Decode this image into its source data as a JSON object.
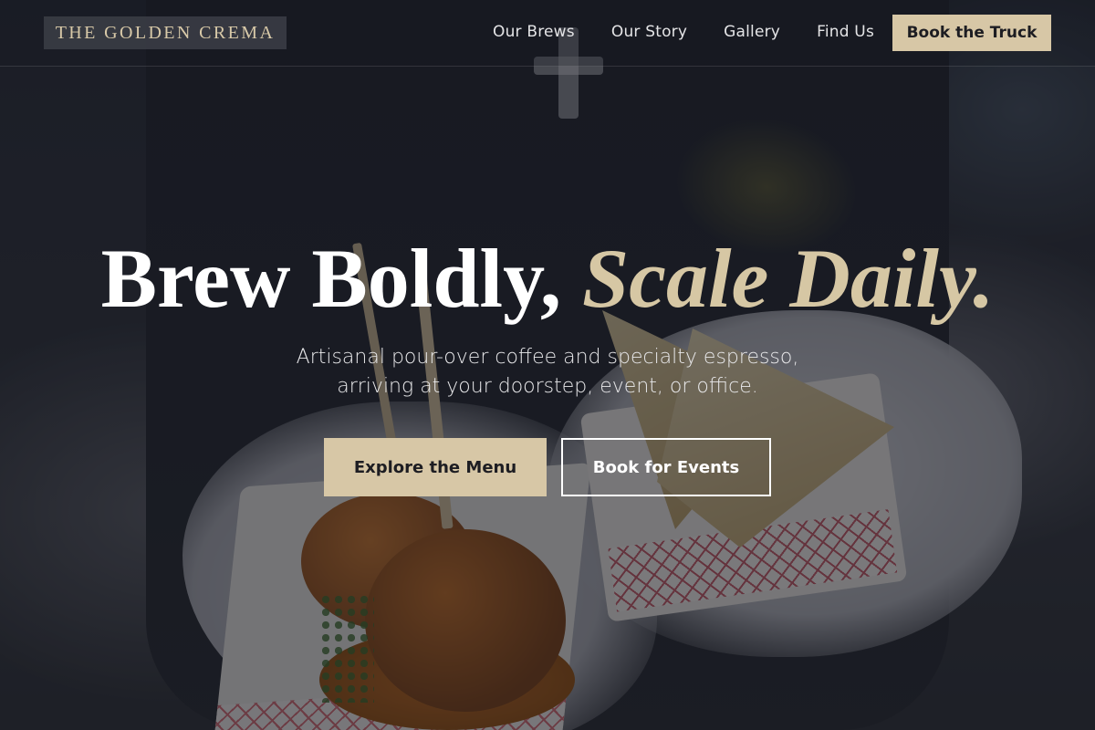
{
  "header": {
    "brand": "THE GOLDEN CREMA",
    "nav": [
      {
        "label": "Our Brews"
      },
      {
        "label": "Our Story"
      },
      {
        "label": "Gallery"
      },
      {
        "label": "Find Us"
      }
    ],
    "cta_label": "Book the Truck"
  },
  "hero": {
    "headline_main": "Brew Boldly, ",
    "headline_accent": "Scale Daily.",
    "subtext_line1": "Artisanal pour-over coffee and specialty espresso,",
    "subtext_line2": "arriving at your doorstep, event, or office.",
    "primary_button": "Explore the Menu",
    "secondary_button": "Book for Events"
  },
  "colors": {
    "accent": "#d7c7a6",
    "overlay": "#14161e",
    "text": "#ffffff"
  }
}
